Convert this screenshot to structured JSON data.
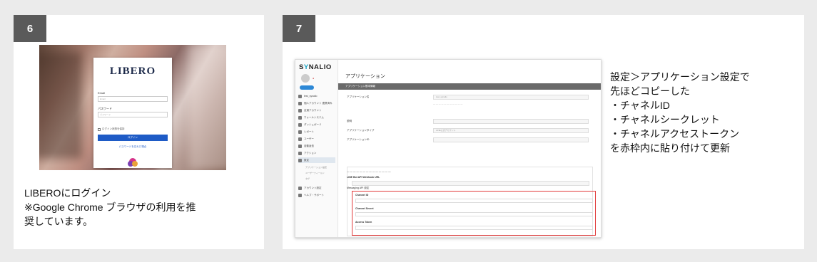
{
  "step6": {
    "badge": "6",
    "login": {
      "logo": "LIBERO",
      "email_label": "Email",
      "email_placeholder": "Email",
      "password_label": "パスワード",
      "password_placeholder": "パスワード",
      "remember_label": "ログイン状態を保持",
      "login_button": "ログイン",
      "forgot_link": "パスワードを忘れた場合"
    },
    "caption": [
      "LIBEROにログイン",
      "※Google Chrome ブラウザの利用を推",
      "奨しています。"
    ]
  },
  "step7": {
    "badge": "7",
    "synalio": {
      "logo_prefix": "S",
      "logo_accent": "Y",
      "logo_suffix": "NALIO",
      "page_title": "アプリケーション",
      "section_bar": "アプリケーション基本情報",
      "nav": [
        "test_synalio",
        "個人アカウント 連携済み",
        "友達アカウント",
        "ウォールシステム",
        "ダッシュボード",
        "レポート",
        "ユーザー",
        "自動返信",
        "アクション",
        "設定",
        "アカウント設定",
        "ヘルプ・サポート"
      ],
      "subnav": [
        "アプリケーション設定",
        "ユーザーフィールド",
        "タグ"
      ],
      "fields": [
        {
          "label": "アプリケーション名",
          "value": "test_synalio"
        },
        {
          "label": "説明",
          "value": ""
        },
        {
          "label": "アプリケーションタイプ",
          "value": "LINE公式アカウント"
        },
        {
          "label": "アプリケーションID",
          "value": ""
        }
      ],
      "webhook_label": "LINE Bot API Webhook URL",
      "messaging_label": "Messaging API 設定",
      "red_fields": [
        "Channel ID",
        "Channel Secret",
        "Access Token"
      ]
    },
    "caption": [
      "設定＞アプリケーション設定で",
      "先ほどコピーした",
      "・チャネルID",
      "・チャネルシークレット",
      "・チャネルアクセストークン",
      "を赤枠内に貼り付けて更新"
    ]
  },
  "colors": {
    "background": "#ebebeb",
    "badge": "#5a5a5a",
    "login_button": "#1e5bc6",
    "highlight_border": "#e23b3b",
    "synalio_accent": "#1aa3c4"
  }
}
